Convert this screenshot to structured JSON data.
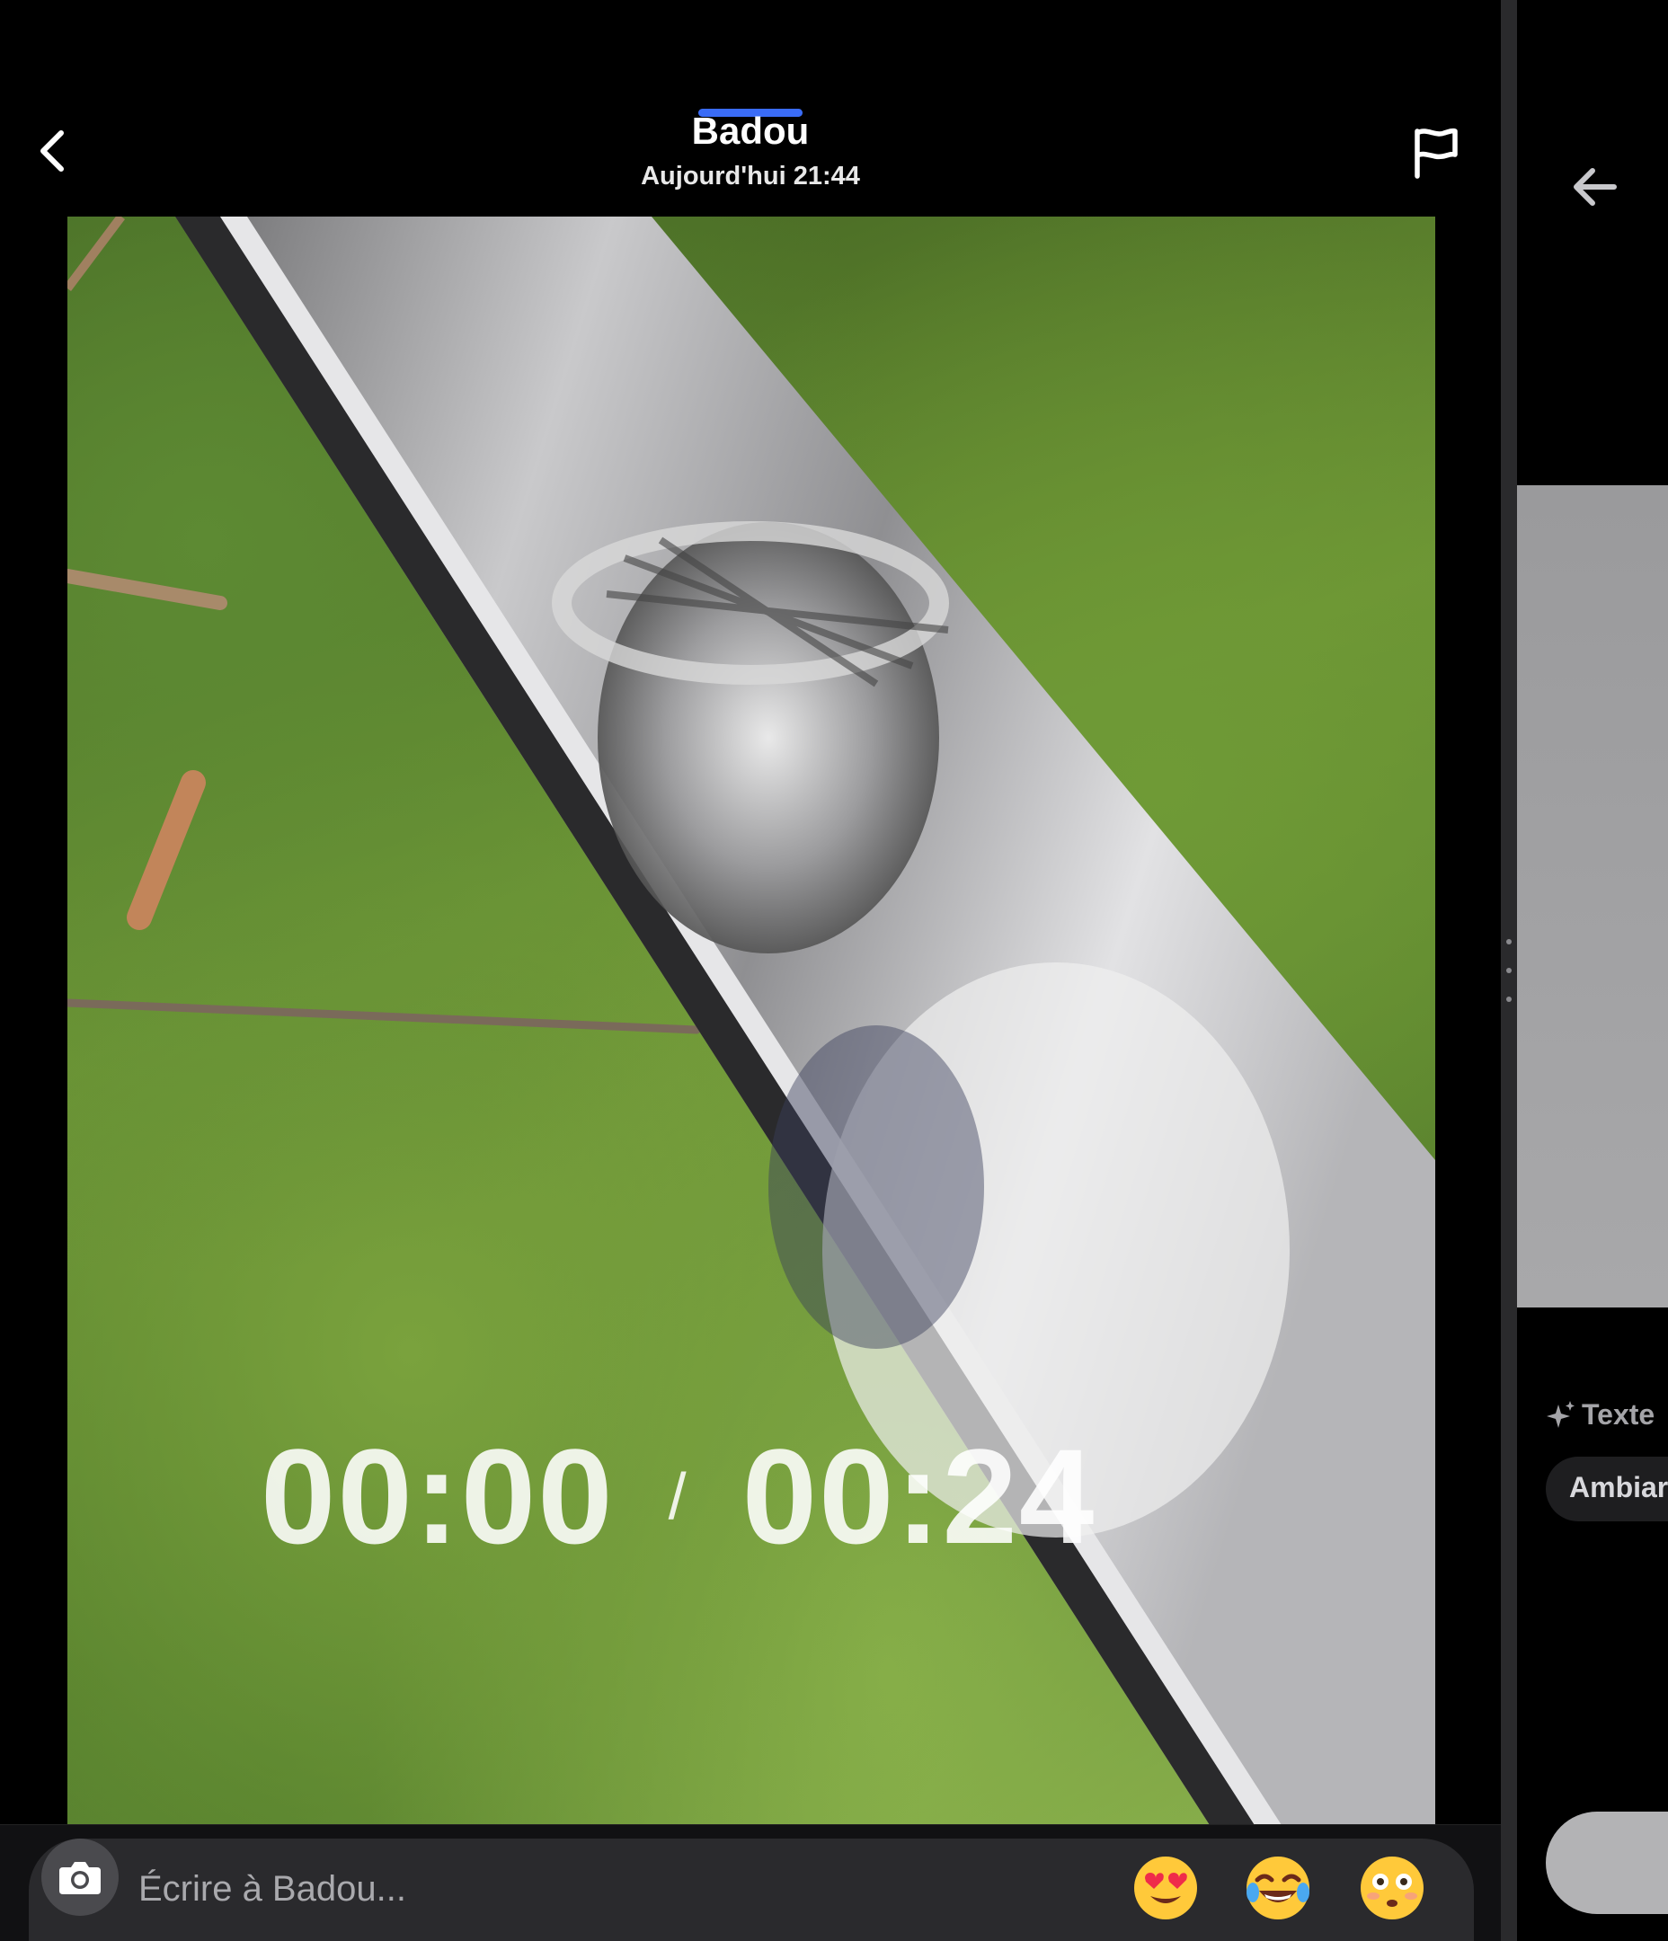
{
  "header": {
    "contact_name": "Badou",
    "timestamp": "Aujourd'hui 21:44",
    "back_icon": "chevron-left-icon",
    "report_icon": "flag-icon",
    "accent_color": "#3a6cf6"
  },
  "media": {
    "type": "video",
    "current_time": "00:00",
    "separator": "/",
    "duration": "00:24"
  },
  "composer": {
    "camera_icon": "camera-icon",
    "placeholder": "Écrire à Badou...",
    "quick_reactions": [
      "😍",
      "😂",
      "😳"
    ]
  },
  "side_panel": {
    "back_icon": "arrow-left-icon",
    "section_label": "Texte",
    "chip_label": "Ambiar"
  }
}
